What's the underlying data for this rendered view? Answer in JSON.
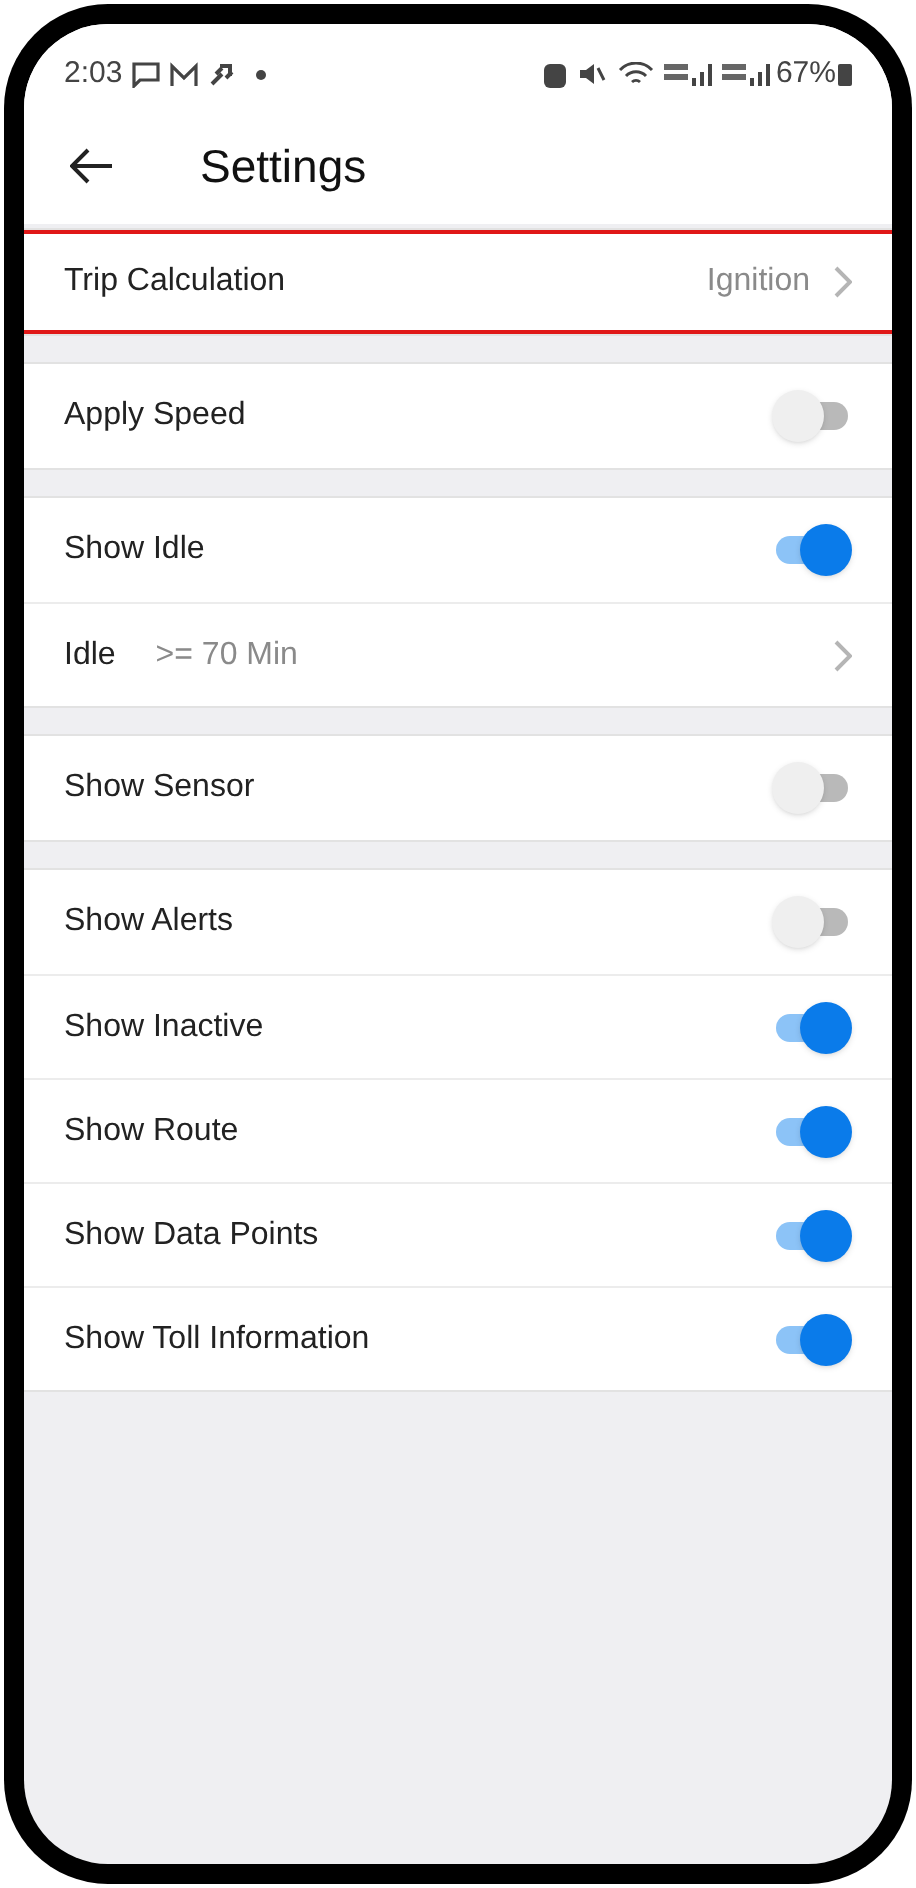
{
  "status_bar": {
    "time": "2:03",
    "battery": "67%"
  },
  "header": {
    "title": "Settings"
  },
  "sections": [
    {
      "rows": [
        {
          "kind": "nav",
          "label": "Trip Calculation",
          "value": "Ignition",
          "highlighted": true
        }
      ]
    },
    {
      "rows": [
        {
          "kind": "toggle",
          "label": "Apply Speed",
          "on": false
        }
      ]
    },
    {
      "rows": [
        {
          "kind": "toggle",
          "label": "Show Idle",
          "on": true
        },
        {
          "kind": "nav",
          "label": "Idle",
          "value": ">= 70 Min",
          "highlighted": false
        }
      ]
    },
    {
      "rows": [
        {
          "kind": "toggle",
          "label": "Show Sensor",
          "on": false
        }
      ]
    },
    {
      "rows": [
        {
          "kind": "toggle",
          "label": "Show Alerts",
          "on": false
        },
        {
          "kind": "toggle",
          "label": "Show Inactive",
          "on": true
        },
        {
          "kind": "toggle",
          "label": "Show Route",
          "on": true
        },
        {
          "kind": "toggle",
          "label": "Show Data Points",
          "on": true
        },
        {
          "kind": "toggle",
          "label": "Show Toll Information",
          "on": true
        }
      ]
    }
  ]
}
